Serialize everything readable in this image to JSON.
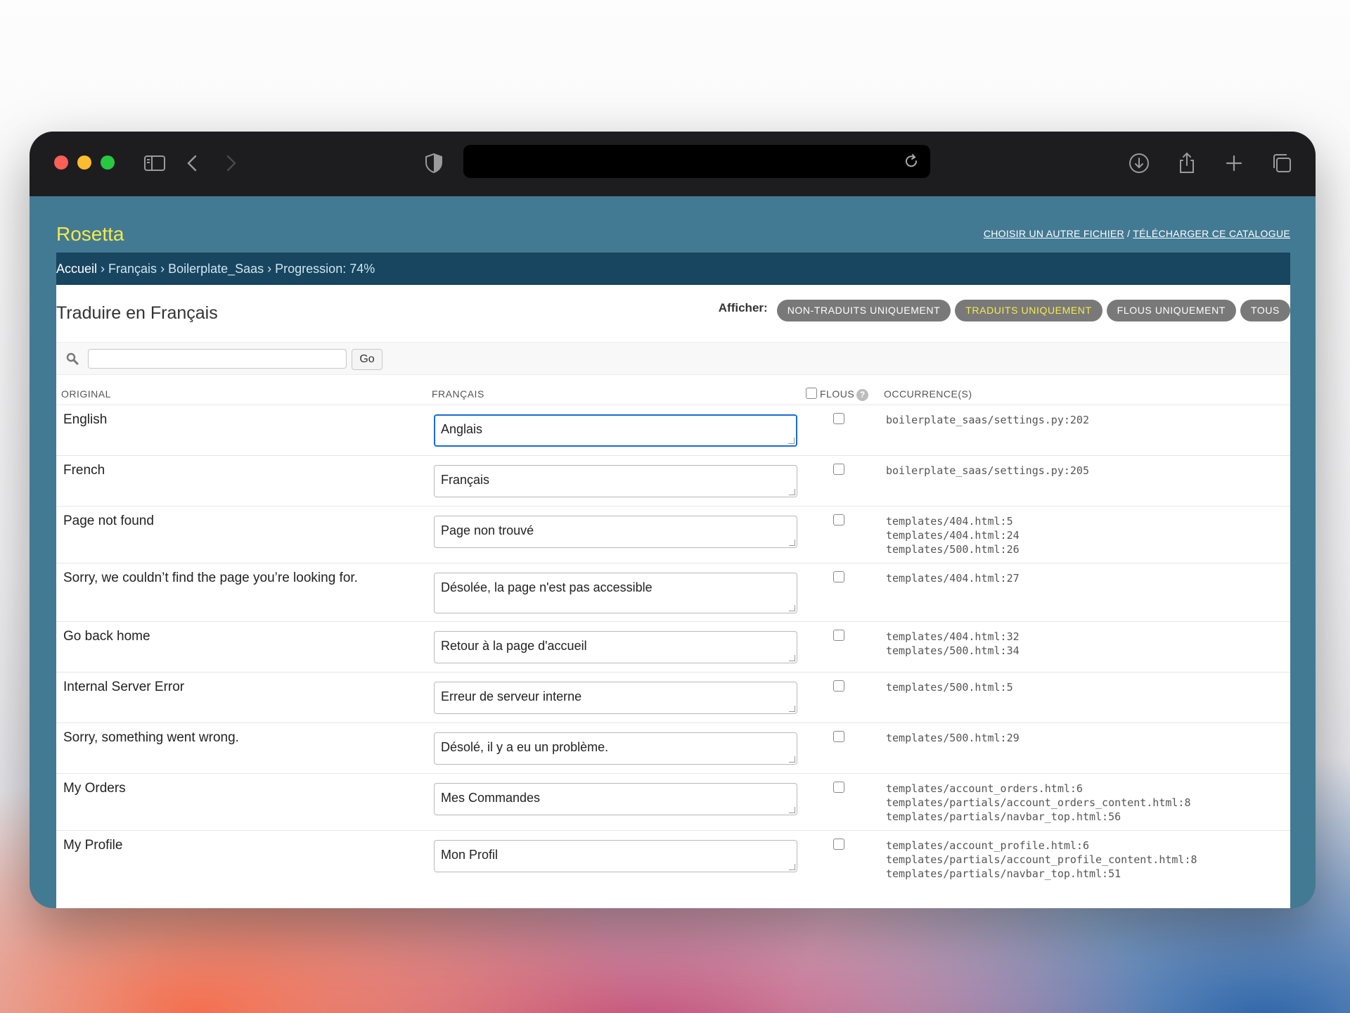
{
  "app": {
    "brand": "Rosetta",
    "header_links": {
      "choose_file": "CHOISIR UN AUTRE FICHIER",
      "separator": " / ",
      "download": "TÉLÉCHARGER CE CATALOGUE"
    }
  },
  "breadcrumb": {
    "home": "Accueil",
    "sep1": " › ",
    "language": "Français",
    "sep2": " › ",
    "project": "Boilerplate_Saas",
    "sep3": " › ",
    "progress": "Progression: 74%"
  },
  "page": {
    "title": "Traduire en Français",
    "filter_label": "Afficher:",
    "filters": [
      {
        "label": "NON-TRADUITS UNIQUEMENT",
        "active": false
      },
      {
        "label": "TRADUITS UNIQUEMENT",
        "active": true
      },
      {
        "label": "FLOUS UNIQUEMENT",
        "active": false
      },
      {
        "label": "TOUS",
        "active": false
      }
    ]
  },
  "search": {
    "placeholder": "",
    "value": "",
    "go_label": "Go"
  },
  "table": {
    "headers": {
      "original": "ORIGINAL",
      "translation": "FRANÇAIS",
      "fuzzy": "FLOUS",
      "help": "?",
      "occurrences": "OCCURRENCE(S)"
    },
    "rows": [
      {
        "original": "English",
        "translation": "Anglais",
        "fuzzy": false,
        "occurrences": [
          "boilerplate_saas/settings.py:202"
        ]
      },
      {
        "original": "French",
        "translation": "Français",
        "fuzzy": false,
        "occurrences": [
          "boilerplate_saas/settings.py:205"
        ]
      },
      {
        "original": "Page not found",
        "translation": "Page non trouvé",
        "fuzzy": false,
        "occurrences": [
          "templates/404.html:5",
          "templates/404.html:24",
          "templates/500.html:26"
        ]
      },
      {
        "original": "Sorry, we couldn’t find the page you’re looking for.",
        "translation": "Désolée, la page n'est pas accessible",
        "fuzzy": false,
        "occurrences": [
          "templates/404.html:27"
        ]
      },
      {
        "original": "Go back home",
        "translation": "Retour à la page d'accueil",
        "fuzzy": false,
        "occurrences": [
          "templates/404.html:32",
          "templates/500.html:34"
        ]
      },
      {
        "original": "Internal Server Error",
        "translation": "Erreur de serveur interne",
        "fuzzy": false,
        "occurrences": [
          "templates/500.html:5"
        ]
      },
      {
        "original": "Sorry, something went wrong.",
        "translation": "Désolé, il y a eu un problème.",
        "fuzzy": false,
        "occurrences": [
          "templates/500.html:29"
        ]
      },
      {
        "original": "My Orders",
        "translation": "Mes Commandes",
        "fuzzy": false,
        "occurrences": [
          "templates/account_orders.html:6",
          "templates/partials/account_orders_content.html:8",
          "templates/partials/navbar_top.html:56"
        ]
      },
      {
        "original": "My Profile",
        "translation": "Mon Profil",
        "fuzzy": false,
        "occurrences": [
          "templates/account_profile.html:6",
          "templates/partials/account_profile_content.html:8",
          "templates/partials/navbar_top.html:51"
        ]
      }
    ]
  }
}
